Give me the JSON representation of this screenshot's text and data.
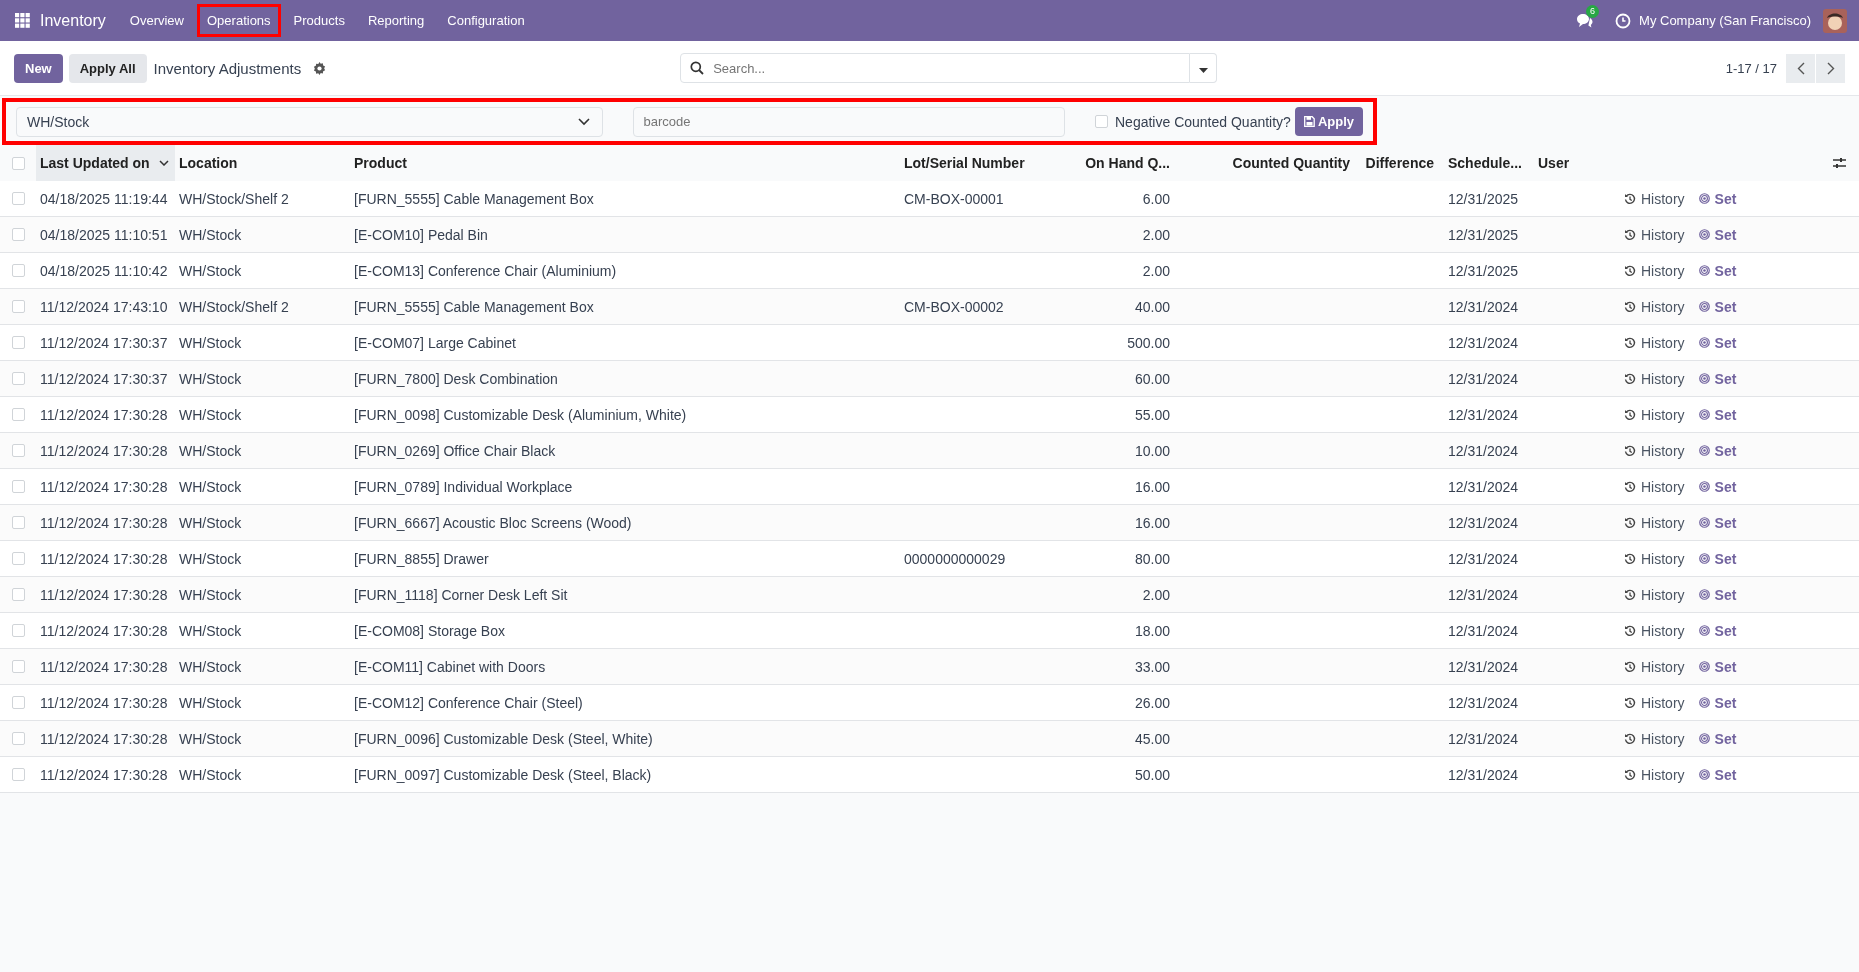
{
  "navbar": {
    "app_name": "Inventory",
    "menu": [
      {
        "label": "Overview",
        "highlighted": false
      },
      {
        "label": "Operations",
        "highlighted": true
      },
      {
        "label": "Products",
        "highlighted": false
      },
      {
        "label": "Reporting",
        "highlighted": false
      },
      {
        "label": "Configuration",
        "highlighted": false
      }
    ],
    "message_count": "6",
    "company": "My Company (San Francisco)"
  },
  "control_panel": {
    "buttons": [
      "New",
      "Apply All"
    ],
    "title": "Inventory Adjustments",
    "search": {
      "placeholder": "Search..."
    },
    "pager": "1-17 / 17"
  },
  "filter_bar": {
    "highlighted": true,
    "location": "WH/Stock",
    "barcode": {
      "placeholder": "barcode"
    },
    "negative_counted": {
      "label": "Negative Counted Quantity?",
      "checked": false
    },
    "apply_button": "Apply"
  },
  "table": {
    "select_all": {
      "checked": false
    },
    "columns": [
      "Last Updated on",
      "Location",
      "Product",
      "Lot/Serial Number",
      "On Hand Q...",
      "Counted Quantity",
      "Difference",
      "Schedule...",
      "User"
    ],
    "rows": [
      {
        "selected": false,
        "updated": "04/18/2025 11:19:44",
        "location": "WH/Stock/Shelf 2",
        "product": "[FURN_5555] Cable Management Box",
        "lot": "CM-BOX-00001",
        "on_hand": "6.00",
        "scheduled": "12/31/2025",
        "history": "History",
        "set": "Set"
      },
      {
        "selected": false,
        "updated": "04/18/2025 11:10:51",
        "location": "WH/Stock",
        "product": "[E-COM10] Pedal Bin",
        "on_hand": "2.00",
        "scheduled": "12/31/2025",
        "history": "History",
        "set": "Set"
      },
      {
        "selected": false,
        "updated": "04/18/2025 11:10:42",
        "location": "WH/Stock",
        "product": "[E-COM13] Conference Chair (Aluminium)",
        "on_hand": "2.00",
        "scheduled": "12/31/2025",
        "history": "History",
        "set": "Set"
      },
      {
        "selected": false,
        "updated": "11/12/2024 17:43:10",
        "location": "WH/Stock/Shelf 2",
        "product": "[FURN_5555] Cable Management Box",
        "lot": "CM-BOX-00002",
        "on_hand": "40.00",
        "scheduled": "12/31/2024",
        "history": "History",
        "set": "Set"
      },
      {
        "selected": false,
        "updated": "11/12/2024 17:30:37",
        "location": "WH/Stock",
        "product": "[E-COM07] Large Cabinet",
        "on_hand": "500.00",
        "scheduled": "12/31/2024",
        "history": "History",
        "set": "Set"
      },
      {
        "selected": false,
        "updated": "11/12/2024 17:30:37",
        "location": "WH/Stock",
        "product": "[FURN_7800] Desk Combination",
        "on_hand": "60.00",
        "scheduled": "12/31/2024",
        "history": "History",
        "set": "Set"
      },
      {
        "selected": false,
        "updated": "11/12/2024 17:30:28",
        "location": "WH/Stock",
        "product": "[FURN_0098] Customizable Desk (Aluminium, White)",
        "on_hand": "55.00",
        "scheduled": "12/31/2024",
        "history": "History",
        "set": "Set"
      },
      {
        "selected": false,
        "updated": "11/12/2024 17:30:28",
        "location": "WH/Stock",
        "product": "[FURN_0269] Office Chair Black",
        "on_hand": "10.00",
        "scheduled": "12/31/2024",
        "history": "History",
        "set": "Set"
      },
      {
        "selected": false,
        "updated": "11/12/2024 17:30:28",
        "location": "WH/Stock",
        "product": "[FURN_0789] Individual Workplace",
        "on_hand": "16.00",
        "scheduled": "12/31/2024",
        "history": "History",
        "set": "Set"
      },
      {
        "selected": false,
        "updated": "11/12/2024 17:30:28",
        "location": "WH/Stock",
        "product": "[FURN_6667] Acoustic Bloc Screens (Wood)",
        "on_hand": "16.00",
        "scheduled": "12/31/2024",
        "history": "History",
        "set": "Set"
      },
      {
        "selected": false,
        "updated": "11/12/2024 17:30:28",
        "location": "WH/Stock",
        "product": "[FURN_8855] Drawer",
        "lot": "0000000000029",
        "on_hand": "80.00",
        "scheduled": "12/31/2024",
        "history": "History",
        "set": "Set"
      },
      {
        "selected": false,
        "updated": "11/12/2024 17:30:28",
        "location": "WH/Stock",
        "product": "[FURN_1118] Corner Desk Left Sit",
        "on_hand": "2.00",
        "scheduled": "12/31/2024",
        "history": "History",
        "set": "Set"
      },
      {
        "selected": false,
        "updated": "11/12/2024 17:30:28",
        "location": "WH/Stock",
        "product": "[E-COM08] Storage Box",
        "on_hand": "18.00",
        "scheduled": "12/31/2024",
        "history": "History",
        "set": "Set"
      },
      {
        "selected": false,
        "updated": "11/12/2024 17:30:28",
        "location": "WH/Stock",
        "product": "[E-COM11] Cabinet with Doors",
        "on_hand": "33.00",
        "scheduled": "12/31/2024",
        "history": "History",
        "set": "Set"
      },
      {
        "selected": false,
        "updated": "11/12/2024 17:30:28",
        "location": "WH/Stock",
        "product": "[E-COM12] Conference Chair (Steel)",
        "on_hand": "26.00",
        "scheduled": "12/31/2024",
        "history": "History",
        "set": "Set"
      },
      {
        "selected": false,
        "updated": "11/12/2024 17:30:28",
        "location": "WH/Stock",
        "product": "[FURN_0096] Customizable Desk (Steel, White)",
        "on_hand": "45.00",
        "scheduled": "12/31/2024",
        "history": "History",
        "set": "Set"
      },
      {
        "selected": false,
        "updated": "11/12/2024 17:30:28",
        "location": "WH/Stock",
        "product": "[FURN_0097] Customizable Desk (Steel, Black)",
        "on_hand": "50.00",
        "scheduled": "12/31/2024",
        "history": "History",
        "set": "Set"
      }
    ]
  }
}
